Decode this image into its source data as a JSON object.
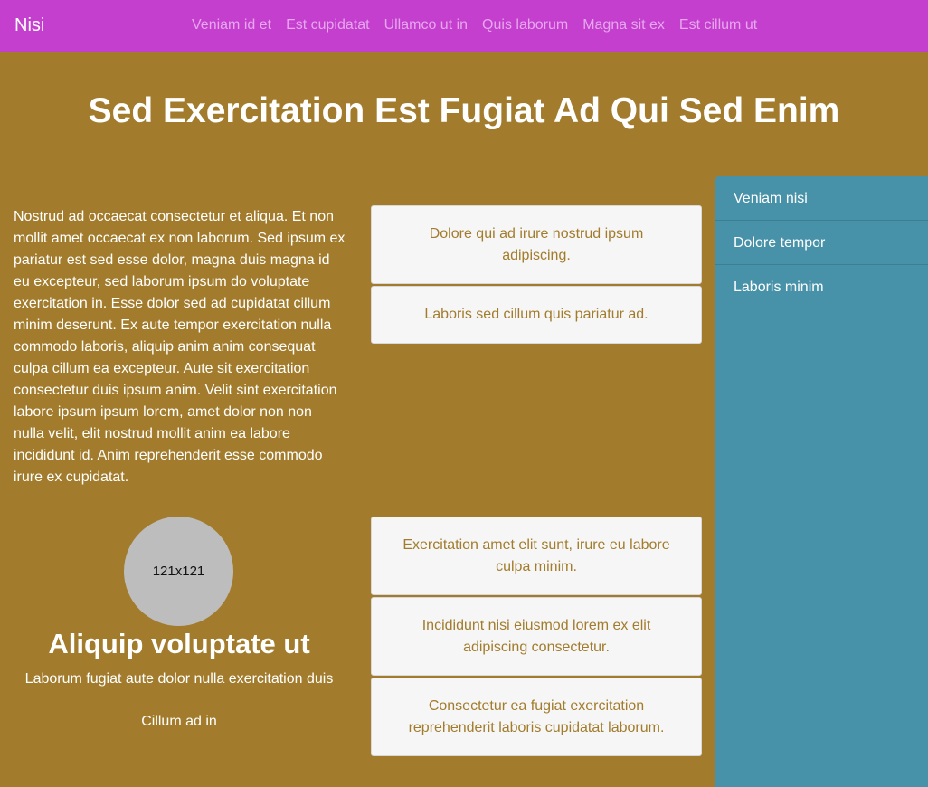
{
  "navbar": {
    "brand": "Nisi",
    "links": [
      "Veniam id et",
      "Est cupidatat",
      "Ullamco ut in",
      "Quis laborum",
      "Magna sit ex",
      "Est cillum ut"
    ]
  },
  "page": {
    "title": "Sed Exercitation Est Fugiat Ad Qui Sed Enim"
  },
  "intro": {
    "text": "Nostrud ad occaecat consectetur et aliqua. Et non mollit amet occaecat ex non laborum. Sed ipsum ex pariatur est sed esse dolor, magna duis magna id eu excepteur, sed laborum ipsum do voluptate exercitation in. Esse dolor sed ad cupidatat cillum minim deserunt. Ex aute tempor exercitation nulla commodo laboris, aliquip anim anim consequat culpa cillum ea excepteur. Aute sit exercitation consectetur duis ipsum anim. Velit sint exercitation labore ipsum ipsum lorem, amet dolor non non nulla velit, elit nostrud mollit anim ea labore incididunt id. Anim reprehenderit esse commodo irure ex cupidatat."
  },
  "cards_top": [
    "Dolore qui ad irure nostrud ipsum adipiscing.",
    "Laboris sed cillum quis pariatur ad."
  ],
  "cards_bottom": [
    "Exercitation amet elit sunt, irure eu labore culpa minim.",
    "Incididunt nisi eiusmod lorem ex elit adipiscing consectetur.",
    "Consectetur ea fugiat exercitation reprehenderit laboris cupidatat laborum."
  ],
  "feature": {
    "avatar_text": "121x121",
    "heading": "Aliquip voluptate ut",
    "text": "Laborum fugiat aute dolor nulla exercitation duis",
    "link": "Cillum ad in"
  },
  "sidebar": {
    "items": [
      "Veniam nisi",
      "Dolore tempor",
      "Laboris minim"
    ]
  },
  "colors": {
    "navbar": "#c43fcd",
    "nav_link": "#e6a7ee",
    "background": "#a27c2c",
    "sidebar": "#4792a8",
    "card": "#f6f6f6"
  }
}
